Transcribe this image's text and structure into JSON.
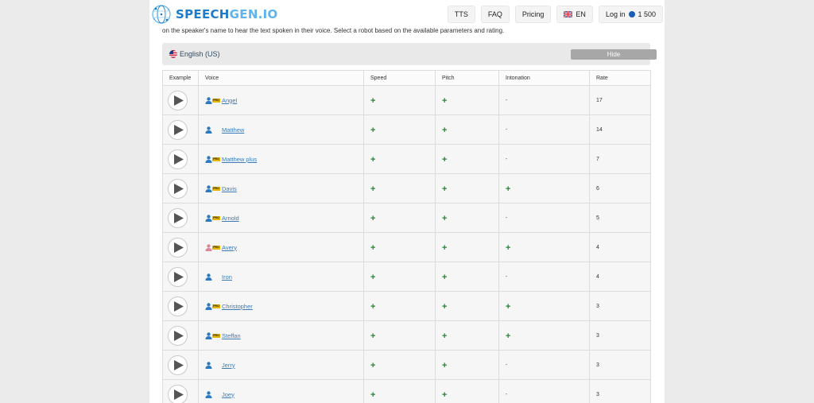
{
  "header": {
    "logo_primary": "SPEECH",
    "logo_secondary": "GEN.IO",
    "nav": {
      "tts": "TTS",
      "faq": "FAQ",
      "pricing": "Pricing",
      "lang": "EN",
      "login": "Log in",
      "credits": "1 500"
    }
  },
  "intro_text": "on the speaker's name to hear the text spoken in their voice. Select a robot based on the available parameters and rating.",
  "language_bar": {
    "label": "English (US)",
    "hide_label": "Hide"
  },
  "table": {
    "columns": [
      "Example",
      "Voice",
      "Speed",
      "Pitch",
      "Intonation",
      "Rate"
    ],
    "pro_badge": "PRO",
    "rows": [
      {
        "voice": "Angel",
        "pro": true,
        "icon_color": "#2a7bc4",
        "speed": "+",
        "pitch": "+",
        "intonation": "-",
        "rate": "17"
      },
      {
        "voice": "Matthew",
        "pro": false,
        "icon_color": "#2a7bc4",
        "speed": "+",
        "pitch": "+",
        "intonation": "-",
        "rate": "14"
      },
      {
        "voice": "Matthew plus",
        "pro": true,
        "icon_color": "#2a7bc4",
        "speed": "+",
        "pitch": "+",
        "intonation": "-",
        "rate": "7"
      },
      {
        "voice": "Davis",
        "pro": true,
        "icon_color": "#2a7bc4",
        "speed": "+",
        "pitch": "+",
        "intonation": "+",
        "rate": "6"
      },
      {
        "voice": "Arnold",
        "pro": true,
        "icon_color": "#2a7bc4",
        "speed": "+",
        "pitch": "+",
        "intonation": "-",
        "rate": "5"
      },
      {
        "voice": "Avery",
        "pro": true,
        "icon_color": "#e0849a",
        "speed": "+",
        "pitch": "+",
        "intonation": "+",
        "rate": "4"
      },
      {
        "voice": "Iron",
        "pro": false,
        "icon_color": "#2a7bc4",
        "speed": "+",
        "pitch": "+",
        "intonation": "-",
        "rate": "4"
      },
      {
        "voice": "Christopher",
        "pro": true,
        "icon_color": "#2a7bc4",
        "speed": "+",
        "pitch": "+",
        "intonation": "+",
        "rate": "3"
      },
      {
        "voice": "Steffan",
        "pro": true,
        "icon_color": "#2a7bc4",
        "speed": "+",
        "pitch": "+",
        "intonation": "+",
        "rate": "3"
      },
      {
        "voice": "Jerry",
        "pro": false,
        "icon_color": "#2a7bc4",
        "speed": "+",
        "pitch": "+",
        "intonation": "-",
        "rate": "3"
      },
      {
        "voice": "Joey",
        "pro": false,
        "icon_color": "#2a7bc4",
        "speed": "+",
        "pitch": "+",
        "intonation": "-",
        "rate": "3"
      }
    ]
  },
  "colors": {
    "brand_blue": "#1d7bc9",
    "plus_green": "#1d8a2e",
    "link_blue": "#3a7ab8",
    "pro_gold": "#e5b400"
  }
}
